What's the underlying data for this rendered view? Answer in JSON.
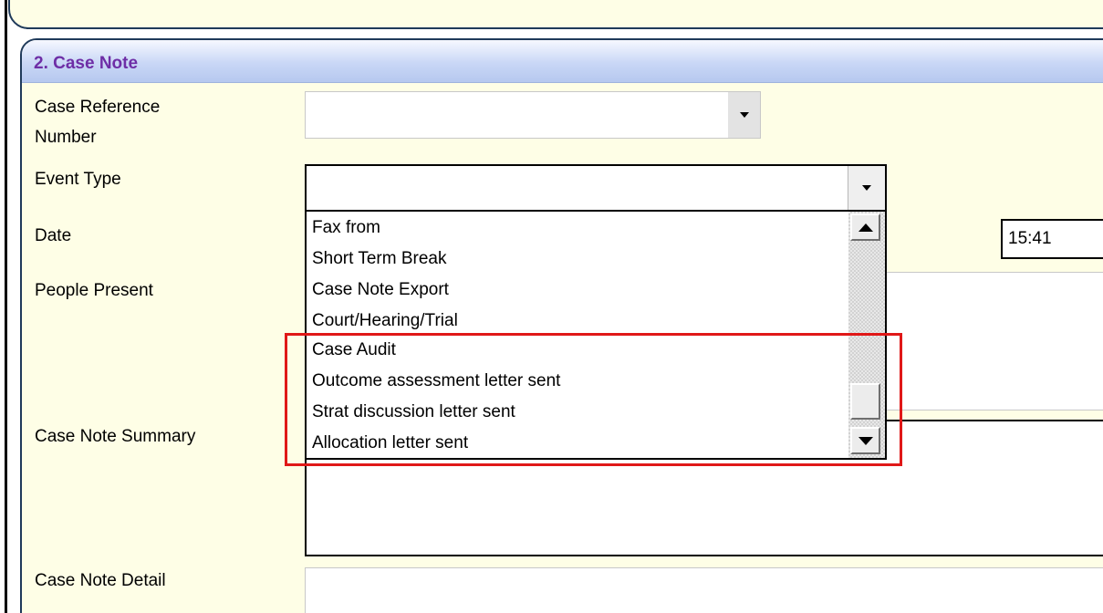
{
  "section": {
    "title": "2. Case Note"
  },
  "labels": {
    "case_reference_line1": "Case Reference",
    "case_reference_line2": "Number",
    "event_type": "Event Type",
    "date": "Date",
    "people_present": "People Present",
    "case_note_summary": "Case Note Summary",
    "case_note_detail": "Case Note Detail"
  },
  "fields": {
    "case_reference_value": "",
    "event_type_value": "",
    "time_value": "15:41"
  },
  "dropdown": {
    "items": [
      "Fax from",
      "Short Term Break",
      "Case Note Export",
      "Court/Hearing/Trial",
      "Case Audit",
      "Outcome assessment letter sent",
      "Strat discussion letter sent",
      "Allocation letter sent"
    ],
    "highlighted_items": [
      "Case Audit",
      "Outcome assessment letter sent",
      "Strat discussion letter sent",
      "Allocation letter sent"
    ]
  },
  "colors": {
    "title": "#6e2ea6",
    "panel_bg": "#fefee6",
    "header_gradient": "#c9d7f6",
    "highlight": "#e01818"
  },
  "icons": {
    "combo_arrow": "chevron-down-icon",
    "scroll_up": "scroll-up-arrow-icon",
    "scroll_down": "scroll-down-arrow-icon"
  }
}
